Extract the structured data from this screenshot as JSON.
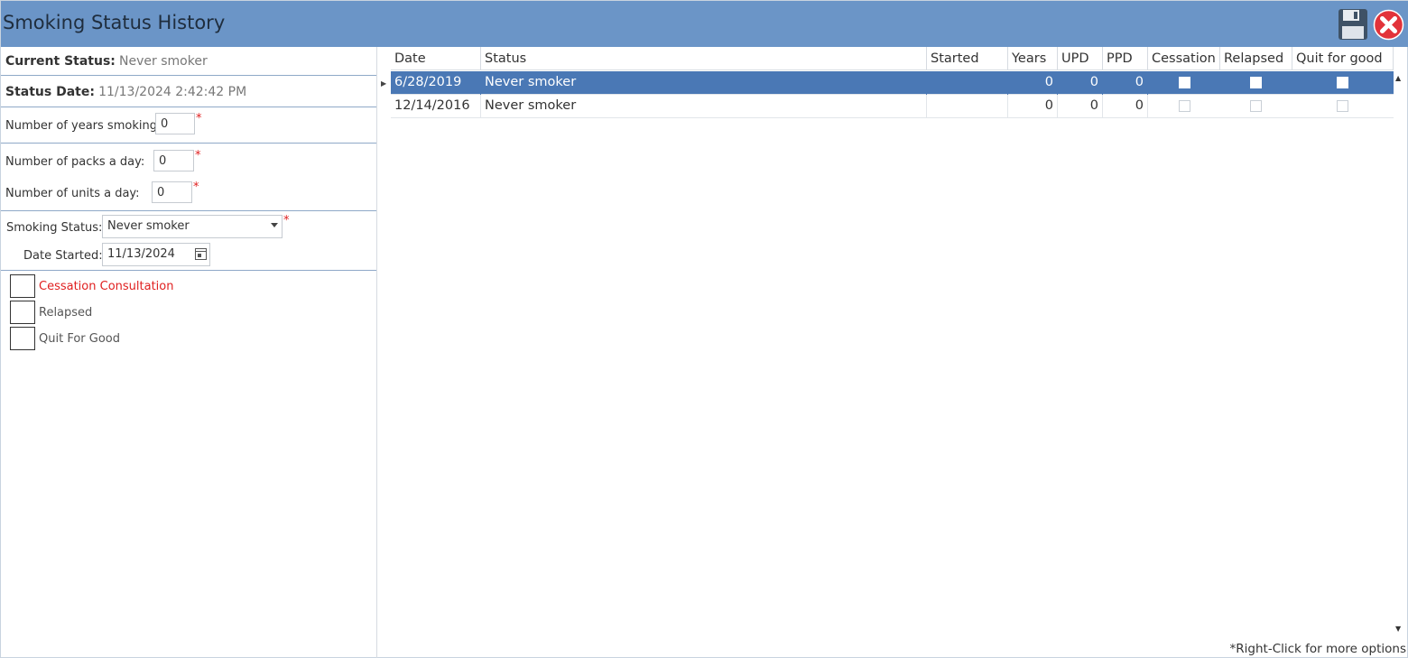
{
  "window": {
    "title": "Smoking Status History"
  },
  "toolbar": {
    "save_icon": "save-icon",
    "close_icon": "close-icon"
  },
  "left": {
    "current_status_label": "Current Status:",
    "current_status_value": "Never smoker",
    "status_date_label": "Status Date:",
    "status_date_value": "11/13/2024 2:42:42 PM",
    "years_smoking_label": "Number of years smoking:",
    "years_smoking_value": "0",
    "packs_label": "Number of packs a day:",
    "packs_value": "0",
    "units_label": "Number of units a day:",
    "units_value": "0",
    "smoking_status_label": "Smoking Status:",
    "smoking_status_value": "Never smoker",
    "date_started_label": "Date Started:",
    "date_started_value": "11/13/2024",
    "required_mark": "*",
    "checkboxes": [
      {
        "label": "Cessation Consultation",
        "checked": false,
        "color": "#e02020"
      },
      {
        "label": "Relapsed",
        "checked": false,
        "color": "#555555"
      },
      {
        "label": "Quit For Good",
        "checked": false,
        "color": "#555555"
      }
    ]
  },
  "grid": {
    "columns": [
      "Date",
      "Status",
      "Started",
      "Years",
      "UPD",
      "PPD",
      "Cessation",
      "Relapsed",
      "Quit for good"
    ],
    "rows": [
      {
        "date": "6/28/2019",
        "status": "Never smoker",
        "started": "",
        "years": "0",
        "upd": "0",
        "ppd": "0",
        "cessation": false,
        "relapsed": false,
        "quit": false,
        "selected": true
      },
      {
        "date": "12/14/2016",
        "status": "Never smoker",
        "started": "",
        "years": "0",
        "upd": "0",
        "ppd": "0",
        "cessation": false,
        "relapsed": false,
        "quit": false,
        "selected": false
      }
    ],
    "hint": "*Right-Click for more options"
  },
  "colors": {
    "titlebar": "#6b95c7",
    "selected_row": "#4a78b5",
    "required": "#e02020"
  }
}
